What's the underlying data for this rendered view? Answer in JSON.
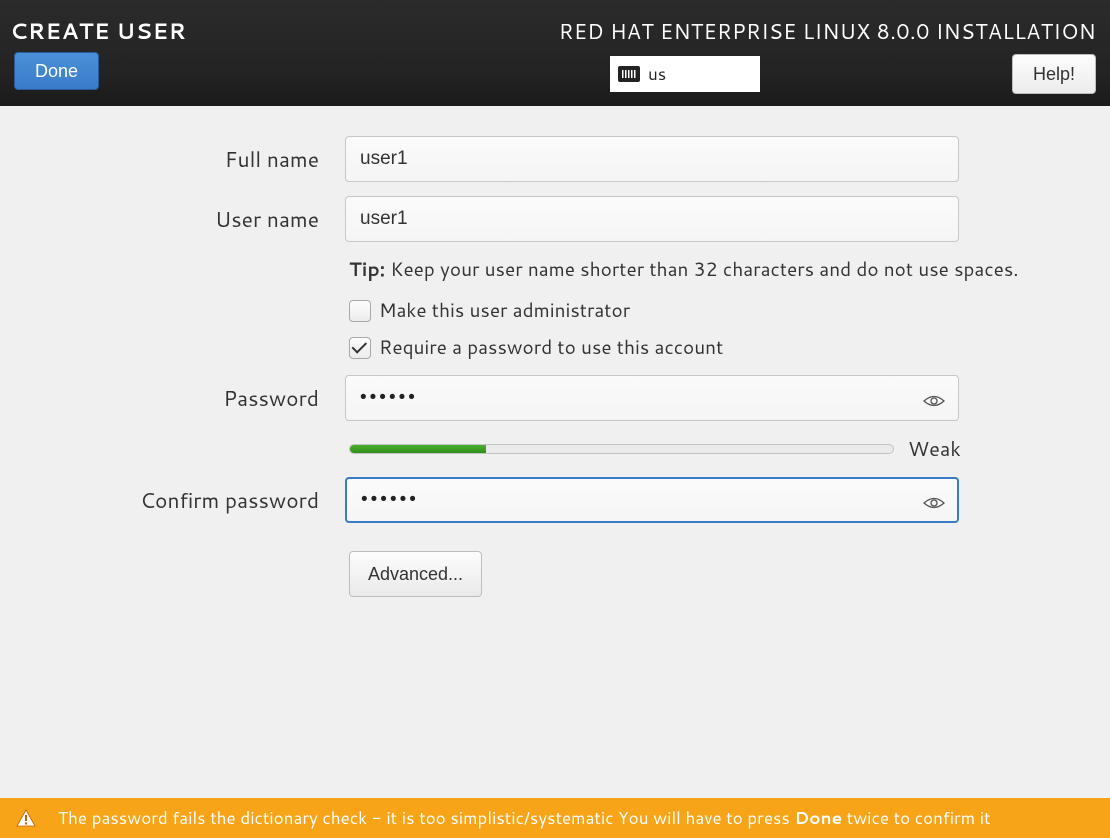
{
  "header": {
    "title": "CREATE USER",
    "subtitle": "RED HAT ENTERPRISE LINUX 8.0.0 INSTALLATION",
    "done_label": "Done",
    "help_label": "Help!",
    "keyboard_layout": "us"
  },
  "form": {
    "fullname_label": "Full name",
    "fullname_value": "user1",
    "username_label": "User name",
    "username_value": "user1",
    "tip_prefix": "Tip:",
    "tip_text": "Keep your user name shorter than 32 characters and do not use spaces.",
    "admin_checkbox_label": "Make this user administrator",
    "admin_checked": false,
    "require_pw_label": "Require a password to use this account",
    "require_pw_checked": true,
    "password_label": "Password",
    "password_value": "••••••",
    "confirm_label": "Confirm password",
    "confirm_value": "••••••",
    "strength_label": "Weak",
    "strength_percent": 25,
    "advanced_label": "Advanced..."
  },
  "warning": {
    "text_pre": "The password fails the dictionary check - it is too simplistic/systematic You will have to press ",
    "text_bold": "Done",
    "text_post": " twice to confirm it"
  }
}
